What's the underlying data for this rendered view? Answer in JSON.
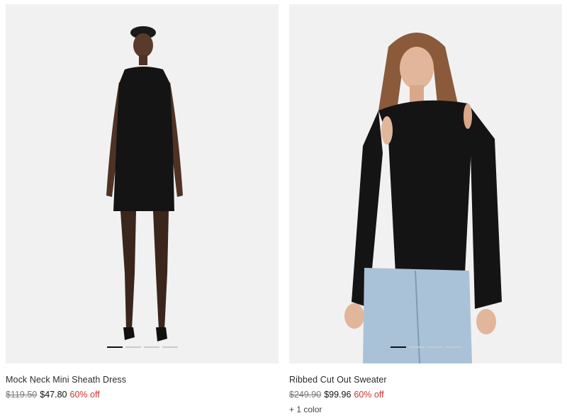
{
  "products": [
    {
      "name": "Mock Neck Mini Sheath Dress",
      "original_price": "$119.50",
      "sale_price": "$47.80",
      "discount": "60% off",
      "carousel_count": 4,
      "carousel_active": 1
    },
    {
      "name": "Ribbed Cut Out Sweater",
      "original_price": "$249.90",
      "sale_price": "$99.96",
      "discount": "60% off",
      "colors": "+ 1 color",
      "carousel_count": 4,
      "carousel_active": 1
    }
  ],
  "colors": {
    "image_bg": "#f1f1f1",
    "discount": "#d0342c",
    "dot_active": "#111111",
    "dot_inactive": "#c9c9c9"
  }
}
